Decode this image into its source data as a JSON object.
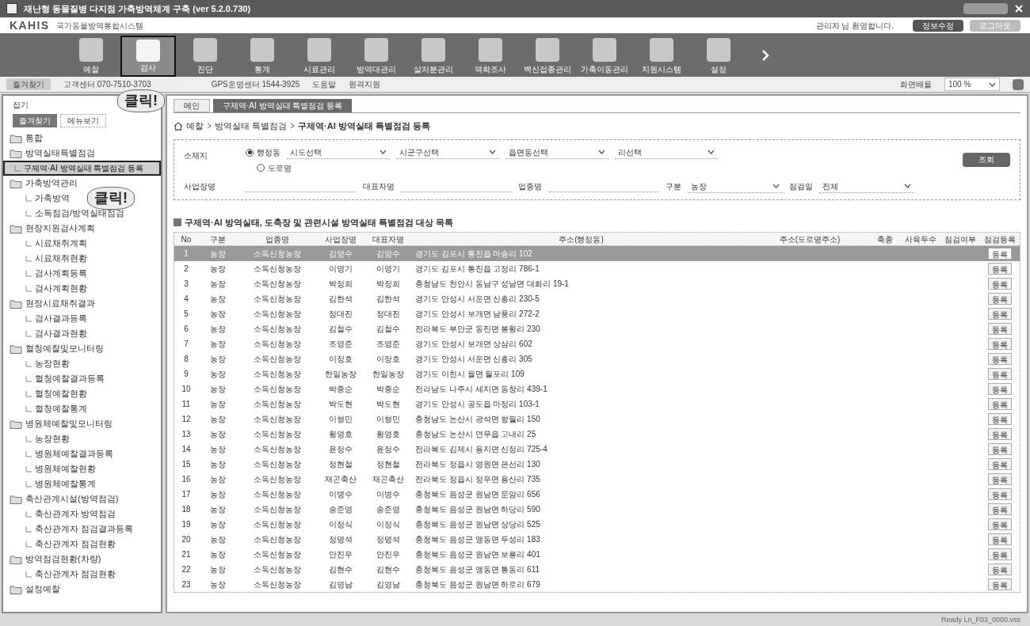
{
  "window": {
    "title": "재난형 동물질병 다지점 가축방역체계 구축 (ver 5.2.0.730)"
  },
  "header": {
    "logo": "KAHIS",
    "subtitle": "국가동물방역통합시스템",
    "greeting": "관리자 님 환영합니다.",
    "buttons": [
      "정보수정",
      "로그아웃"
    ]
  },
  "toolbar": [
    {
      "label": "예찰",
      "selected": false
    },
    {
      "label": "검사",
      "selected": true
    },
    {
      "label": "진단",
      "selected": false
    },
    {
      "label": "통계",
      "selected": false
    },
    {
      "label": "시료관리",
      "selected": false
    },
    {
      "label": "방역대관리",
      "selected": false
    },
    {
      "label": "살처분관리",
      "selected": false
    },
    {
      "label": "역학조사",
      "selected": false
    },
    {
      "label": "백신접종관리",
      "selected": false
    },
    {
      "label": "가축이동관리",
      "selected": false
    },
    {
      "label": "지원시스템",
      "selected": false
    },
    {
      "label": "설정",
      "selected": false
    }
  ],
  "info_bar": {
    "favorites": "즐겨찾기",
    "support": "고객센터 070-7510-3703",
    "gps": "GPS운영센터 1544-3925",
    "help": "도움말",
    "remote": "원격지원",
    "zoom_label": "화면배율",
    "zoom_value": "100 %"
  },
  "sidebar": {
    "collapse": "접기",
    "tabs": [
      {
        "label": "즐겨찾기",
        "selected": true
      },
      {
        "label": "메뉴보기",
        "selected": false
      }
    ],
    "tree": [
      {
        "label": "통합",
        "selected": false
      },
      {
        "label": "방역실태특별점검",
        "selected": false,
        "children": [
          {
            "label": "구제역·AI 방역실태 특별점검 등록",
            "selected": true
          }
        ]
      },
      {
        "label": "가축방역관리",
        "selected": false,
        "children": [
          {
            "label": "가축방역",
            "selected": false
          },
          {
            "label": "소독점검/방역실태점검",
            "selected": false
          }
        ]
      },
      {
        "label": "현장지원검사계획",
        "selected": false,
        "children": [
          {
            "label": "시료채취계획",
            "selected": false
          },
          {
            "label": "시료채취현황",
            "selected": false
          },
          {
            "label": "검사계획등록",
            "selected": false
          },
          {
            "label": "검사계획현황",
            "selected": false
          }
        ]
      },
      {
        "label": "현장시료채취결과",
        "selected": false,
        "children": [
          {
            "label": "검사결과등록",
            "selected": false
          },
          {
            "label": "검사결과현황",
            "selected": false
          }
        ]
      },
      {
        "label": "혈청예찰및모니터링",
        "selected": false,
        "children": [
          {
            "label": "농장현황",
            "selected": false
          },
          {
            "label": "혈청예찰결과등록",
            "selected": false
          },
          {
            "label": "혈청예찰현황",
            "selected": false
          },
          {
            "label": "혈청예찰통계",
            "selected": false
          }
        ]
      },
      {
        "label": "병원체예찰및모니터링",
        "selected": false,
        "children": [
          {
            "label": "농장현황",
            "selected": false
          },
          {
            "label": "병원체예찰결과등록",
            "selected": false
          },
          {
            "label": "병원체예찰현황",
            "selected": false
          },
          {
            "label": "병원체예찰통계",
            "selected": false
          }
        ]
      },
      {
        "label": "축산관계시설(방역점검)",
        "selected": false,
        "children": [
          {
            "label": "축산관계자 방역점검",
            "selected": false
          },
          {
            "label": "축산관계자 점검결과등록",
            "selected": false
          },
          {
            "label": "축산관계자 점검현황",
            "selected": false
          }
        ]
      },
      {
        "label": "방역점검현황(차량)",
        "selected": false,
        "children": [
          {
            "label": "축산관계자 점검현황",
            "selected": false
          }
        ]
      },
      {
        "label": "설정예찰",
        "selected": false
      }
    ]
  },
  "callouts": [
    "클릭!",
    "클릭!"
  ],
  "tabs": [
    {
      "label": "메인",
      "selected": false
    },
    {
      "label": "구제역·AI 방역실태 특별점검 등록",
      "selected": true
    }
  ],
  "breadcrumb": [
    "예찰",
    "방역실태 특별점검",
    "구제역·AI 방역실태 특별점검 등록"
  ],
  "search": {
    "location_label": "소재지",
    "radio": {
      "label": "행정동",
      "selected": true
    },
    "selects": [
      "시도선택",
      "시군구선택",
      "읍면동선택",
      "리선택"
    ],
    "road_radio": {
      "label": "도로명",
      "selected": false
    },
    "business_label": "사업장명",
    "owner_label": "대표자명",
    "industry_label": "업종명",
    "type_label": "구분",
    "type_value": "농장",
    "check_label": "점검일",
    "check_value": "전체",
    "button": "조회"
  },
  "table": {
    "title": "구제역·AI 방역실태, 도축장 및 관련시설 방역실태 특별점검 대상 목록",
    "columns": [
      "No",
      "구분",
      "업종명",
      "사업장명",
      "대표자명",
      "주소(행정동)",
      "주소(도로명주소)",
      "축종",
      "사육두수",
      "점검여부",
      "점검등록"
    ],
    "rows": [
      {
        "no": "1",
        "type": "농장",
        "industry": "소독신청농장",
        "business": "김영수",
        "owner": "김영수",
        "address": "경기도 김포시 통진읍 마송리 102",
        "selected": true,
        "action": "등록"
      },
      {
        "no": "2",
        "type": "농장",
        "industry": "소독신청농장",
        "business": "이영기",
        "owner": "이영기",
        "address": "경기도 김포시 통진읍 고정리 786-1",
        "selected": false,
        "action": "등록"
      },
      {
        "no": "3",
        "type": "농장",
        "industry": "소독신청농장",
        "business": "박정희",
        "owner": "박정희",
        "address": "충청남도 천안시 동남구 성남면 대화리 19-1",
        "selected": false,
        "action": "등록"
      },
      {
        "no": "4",
        "type": "농장",
        "industry": "소독신청농장",
        "business": "김한석",
        "owner": "김한석",
        "address": "경기도 안성시 서운면 신흥리 230-5",
        "selected": false,
        "action": "등록"
      },
      {
        "no": "5",
        "type": "농장",
        "industry": "소독신청농장",
        "business": "정대진",
        "owner": "정대진",
        "address": "경기도 안성시 보개면 남풍리 272-2",
        "selected": false,
        "action": "등록"
      },
      {
        "no": "6",
        "type": "농장",
        "industry": "소독신청농장",
        "business": "김철수",
        "owner": "김철수",
        "address": "전라북도 부안군 동진면 봉황리 230",
        "selected": false,
        "action": "등록"
      },
      {
        "no": "7",
        "type": "농장",
        "industry": "소독신청농장",
        "business": "조영준",
        "owner": "조영준",
        "address": "경기도 안성시 보개면 상삼리 602",
        "selected": false,
        "action": "등록"
      },
      {
        "no": "8",
        "type": "농장",
        "industry": "소독신청농장",
        "business": "이정호",
        "owner": "이정호",
        "address": "경기도 안성시 서운면 신흥리 305",
        "selected": false,
        "action": "등록"
      },
      {
        "no": "9",
        "type": "농장",
        "industry": "소독신청농장",
        "business": "한일농장",
        "owner": "한일농장",
        "address": "경기도 이천시 율면 월포리 109",
        "selected": false,
        "action": "등록"
      },
      {
        "no": "10",
        "type": "농장",
        "industry": "소독신청농장",
        "business": "박종순",
        "owner": "박종순",
        "address": "전라남도 나주시 세지면 동창리 439-1",
        "selected": false,
        "action": "등록"
      },
      {
        "no": "11",
        "type": "농장",
        "industry": "소독신청농장",
        "business": "박도현",
        "owner": "박도현",
        "address": "경기도 안성시 공도읍 마정리 103-1",
        "selected": false,
        "action": "등록"
      },
      {
        "no": "12",
        "type": "농장",
        "industry": "소독신청농장",
        "business": "이형민",
        "owner": "이형민",
        "address": "충청남도 논산시 광석면 항월리 150",
        "selected": false,
        "action": "등록"
      },
      {
        "no": "13",
        "type": "농장",
        "industry": "소독신청농장",
        "business": "황영호",
        "owner": "황영호",
        "address": "충청남도 논산시 연무읍 고내리 25",
        "selected": false,
        "action": "등록"
      },
      {
        "no": "14",
        "type": "농장",
        "industry": "소독신청농장",
        "business": "윤정수",
        "owner": "윤정수",
        "address": "전라북도 김제시 용지면 신정리 725-4",
        "selected": false,
        "action": "등록"
      },
      {
        "no": "15",
        "type": "농장",
        "industry": "소독신청농장",
        "business": "정현철",
        "owner": "정현철",
        "address": "전라북도 정읍시 영원면 은선리 130",
        "selected": false,
        "action": "등록"
      },
      {
        "no": "16",
        "type": "농장",
        "industry": "소독신청농장",
        "business": "재곤축산",
        "owner": "재곤축산",
        "address": "전라북도 정읍시 정우면 용산리 735",
        "selected": false,
        "action": "등록"
      },
      {
        "no": "17",
        "type": "농장",
        "industry": "소독신청농장",
        "business": "이병수",
        "owner": "이병수",
        "address": "충청북도 음성군 원남면 문암리 656",
        "selected": false,
        "action": "등록"
      },
      {
        "no": "18",
        "type": "농장",
        "industry": "소독신청농장",
        "business": "송준영",
        "owner": "송준영",
        "address": "충청북도 음성군 원남면 하당리 590",
        "selected": false,
        "action": "등록"
      },
      {
        "no": "19",
        "type": "농장",
        "industry": "소독신청농장",
        "business": "이정식",
        "owner": "이정식",
        "address": "충청북도 음성군 원남면 상당리 525",
        "selected": false,
        "action": "등록"
      },
      {
        "no": "20",
        "type": "농장",
        "industry": "소독신청농장",
        "business": "정명석",
        "owner": "정명석",
        "address": "충청북도 음성군 맹동면 두성리 183",
        "selected": false,
        "action": "등록"
      },
      {
        "no": "21",
        "type": "농장",
        "industry": "소독신청농장",
        "business": "안진우",
        "owner": "안진우",
        "address": "충청북도 음성군 원남면 보룡리 401",
        "selected": false,
        "action": "등록"
      },
      {
        "no": "22",
        "type": "농장",
        "industry": "소독신청농장",
        "business": "김현수",
        "owner": "김현수",
        "address": "충청북도 음성군 맹동면 통동리 611",
        "selected": false,
        "action": "등록"
      },
      {
        "no": "23",
        "type": "농장",
        "industry": "소독신청농장",
        "business": "김영남",
        "owner": "김영남",
        "address": "충청북도 음성군 원남면 하로리 679",
        "selected": false,
        "action": "등록"
      }
    ]
  },
  "status_bar": "Ready   Ln_F03_0000.vss"
}
